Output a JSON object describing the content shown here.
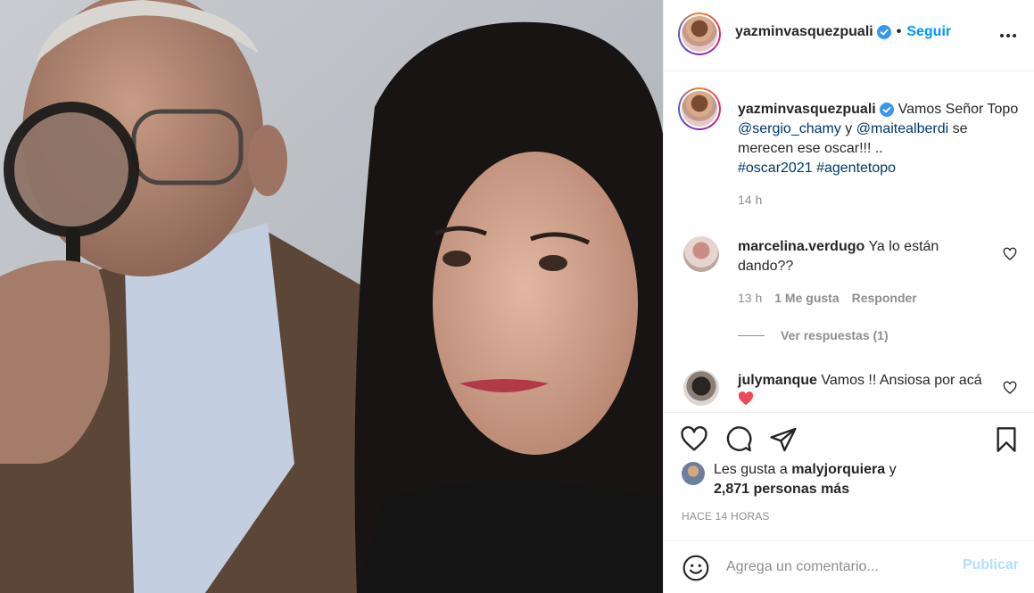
{
  "post": {
    "author": "yazminvasquezpuali",
    "separator": "•",
    "follow_label": "Seguir"
  },
  "caption": {
    "author": "yazminvasquezpuali",
    "text_1": "Vamos Señor Topo",
    "mention_1": "@sergio_chamy",
    "text_2": "y",
    "mention_2": "@maitealberdi",
    "text_3": "se merecen ese oscar!!! ..",
    "hashtag_1": "#oscar2021",
    "hashtag_2": "#agentetopo",
    "time": "14 h"
  },
  "comments": [
    {
      "author": "marcelina.verdugo",
      "text": "Ya lo están dando??",
      "time": "13 h",
      "likes": "1 Me gusta",
      "reply_label": "Responder",
      "view_replies": "Ver respuestas (1)"
    },
    {
      "author": "julymanque",
      "text": "Vamos !! Ansiosa por acá"
    }
  ],
  "likes": {
    "prefix": "Les gusta a",
    "user": "malyjorquiera",
    "conj": "y",
    "count": "2,871 personas más"
  },
  "posted_ago": "HACE 14 HORAS",
  "add_comment": {
    "placeholder": "Agrega un comentario...",
    "publish_label": "Publicar"
  },
  "icons": {
    "like": "heart-icon",
    "comment": "comment-bubble-icon",
    "share": "paper-plane-icon",
    "save": "bookmark-icon",
    "more": "more-dots-icon",
    "emoji": "emoji-face-icon",
    "verified": "verified-badge-icon"
  },
  "colors": {
    "accent": "#0095f6",
    "mention": "#00376b",
    "muted": "#8e8e8e",
    "publish_disabled": "#b2dffc",
    "heart_red": "#ed4956"
  }
}
